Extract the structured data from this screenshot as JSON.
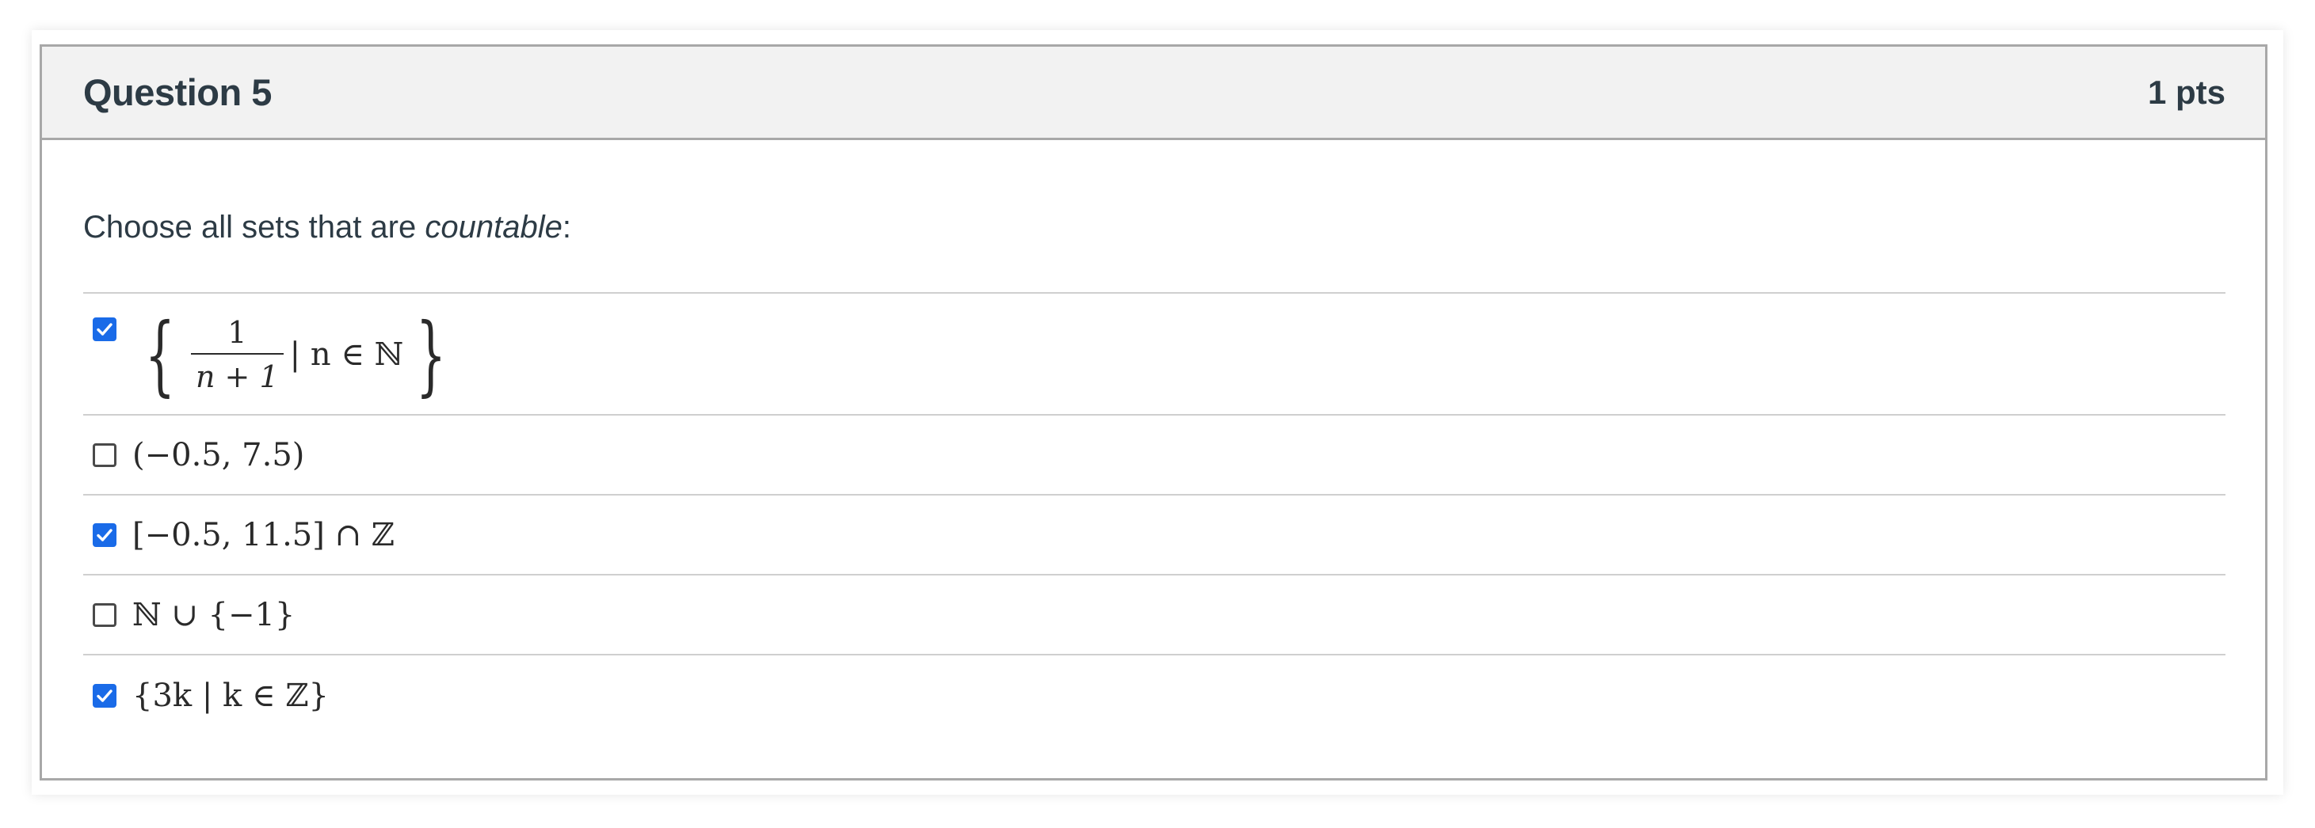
{
  "question": {
    "title": "Question 5",
    "points": "1 pts",
    "prompt_prefix": "Choose all sets that are ",
    "prompt_emphasis": "countable",
    "prompt_suffix": ":"
  },
  "answers": [
    {
      "checked": true,
      "frac_numerator": "1",
      "frac_denominator": "n + 1",
      "rest": "| n ∈ ℕ"
    },
    {
      "checked": false,
      "text": "(−0.5, 7.5)"
    },
    {
      "checked": true,
      "text": "[−0.5, 11.5] ∩ ℤ"
    },
    {
      "checked": false,
      "text": "ℕ ∪ {−1}"
    },
    {
      "checked": true,
      "text": "{3k | k ∈ ℤ}"
    }
  ],
  "colors": {
    "checkbox_checked": "#1a6be8",
    "header_background": "#f2f2f2",
    "border": "#a8a8a8"
  }
}
